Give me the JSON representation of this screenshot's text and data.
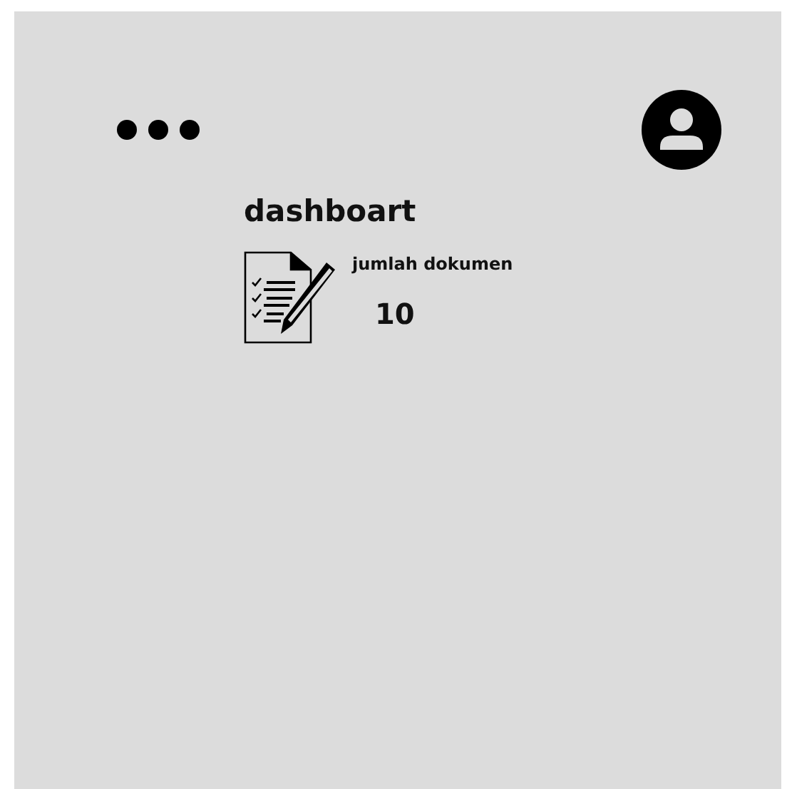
{
  "title": "dashboart",
  "stat": {
    "label": "jumlah dokumen",
    "value": "10"
  }
}
